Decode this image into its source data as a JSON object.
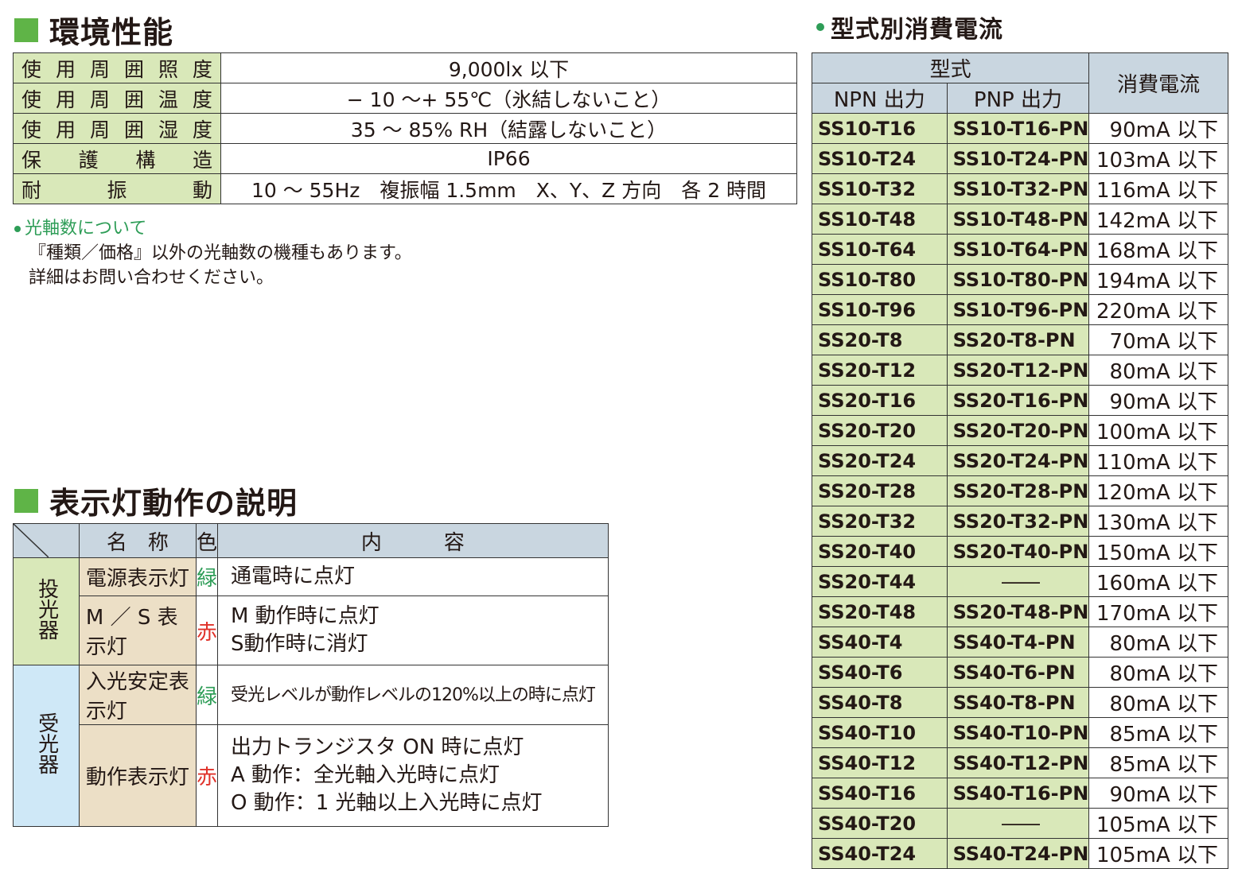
{
  "env": {
    "title": "環境性能",
    "rows": [
      {
        "label": "使用周囲照度",
        "value": "9,000lx 以下"
      },
      {
        "label": "使用周囲温度",
        "value": "− 10 〜+ 55℃（氷結しないこと）"
      },
      {
        "label": "使用周囲湿度",
        "value": "35 〜 85% RH（結露しないこと）"
      },
      {
        "label": "保護構造",
        "value": "IP66"
      },
      {
        "label": "耐振動",
        "value": "10 〜 55Hz　複振幅 1.5mm　X、Y、Z 方向　各 2 時間"
      }
    ]
  },
  "note": {
    "title": "光軸数について",
    "lines": [
      "『種類／価格』以外の光軸数の機種もあります。",
      "詳細はお問い合わせください。"
    ]
  },
  "indicator": {
    "title": "表示灯動作の説明",
    "headers": {
      "name": "名　称",
      "color": "色",
      "content": "内　　　容"
    },
    "groups": [
      {
        "label": "投光器",
        "rows": [
          {
            "name": "電源表示灯",
            "color": "緑",
            "content": [
              "通電時に点灯"
            ]
          },
          {
            "name": "M ／ S 表示灯",
            "color": "赤",
            "content": [
              "M 動作時に点灯",
              "S動作時に消灯"
            ]
          }
        ]
      },
      {
        "label": "受光器",
        "rows": [
          {
            "name": "入光安定表示灯",
            "color": "緑",
            "content": [
              "受光レベルが動作レベルの120%以上の時に点灯"
            ]
          },
          {
            "name": "動作表示灯",
            "color": "赤",
            "content": [
              "出力トランジスタ ON 時に点灯",
              "A 動作：全光軸入光時に点灯",
              "O 動作：1 光軸以上入光時に点灯"
            ]
          }
        ]
      }
    ]
  },
  "current": {
    "title": "型式別消費電流",
    "headers": {
      "model": "型式",
      "npn": "NPN 出力",
      "pnp": "PNP 出力",
      "current": "消費電流"
    },
    "rows": [
      {
        "npn": "SS10-T16",
        "pnp": "SS10-T16-PN",
        "current": "90mA 以下"
      },
      {
        "npn": "SS10-T24",
        "pnp": "SS10-T24-PN",
        "current": "103mA 以下"
      },
      {
        "npn": "SS10-T32",
        "pnp": "SS10-T32-PN",
        "current": "116mA 以下"
      },
      {
        "npn": "SS10-T48",
        "pnp": "SS10-T48-PN",
        "current": "142mA 以下"
      },
      {
        "npn": "SS10-T64",
        "pnp": "SS10-T64-PN",
        "current": "168mA 以下"
      },
      {
        "npn": "SS10-T80",
        "pnp": "SS10-T80-PN",
        "current": "194mA 以下"
      },
      {
        "npn": "SS10-T96",
        "pnp": "SS10-T96-PN",
        "current": "220mA 以下"
      },
      {
        "npn": "SS20-T8",
        "pnp": "SS20-T8-PN",
        "current": "70mA 以下"
      },
      {
        "npn": "SS20-T12",
        "pnp": "SS20-T12-PN",
        "current": "80mA 以下"
      },
      {
        "npn": "SS20-T16",
        "pnp": "SS20-T16-PN",
        "current": "90mA 以下"
      },
      {
        "npn": "SS20-T20",
        "pnp": "SS20-T20-PN",
        "current": "100mA 以下"
      },
      {
        "npn": "SS20-T24",
        "pnp": "SS20-T24-PN",
        "current": "110mA 以下"
      },
      {
        "npn": "SS20-T28",
        "pnp": "SS20-T28-PN",
        "current": "120mA 以下"
      },
      {
        "npn": "SS20-T32",
        "pnp": "SS20-T32-PN",
        "current": "130mA 以下"
      },
      {
        "npn": "SS20-T40",
        "pnp": "SS20-T40-PN",
        "current": "150mA 以下"
      },
      {
        "npn": "SS20-T44",
        "pnp": "――",
        "current": "160mA 以下"
      },
      {
        "npn": "SS20-T48",
        "pnp": "SS20-T48-PN",
        "current": "170mA 以下"
      },
      {
        "npn": "SS40-T4",
        "pnp": "SS40-T4-PN",
        "current": "80mA 以下"
      },
      {
        "npn": "SS40-T6",
        "pnp": "SS40-T6-PN",
        "current": "80mA 以下"
      },
      {
        "npn": "SS40-T8",
        "pnp": "SS40-T8-PN",
        "current": "80mA 以下"
      },
      {
        "npn": "SS40-T10",
        "pnp": "SS40-T10-PN",
        "current": "85mA 以下"
      },
      {
        "npn": "SS40-T12",
        "pnp": "SS40-T12-PN",
        "current": "85mA 以下"
      },
      {
        "npn": "SS40-T16",
        "pnp": "SS40-T16-PN",
        "current": "90mA 以下"
      },
      {
        "npn": "SS40-T20",
        "pnp": "――",
        "current": "105mA 以下"
      },
      {
        "npn": "SS40-T24",
        "pnp": "SS40-T24-PN",
        "current": "105mA 以下"
      }
    ]
  },
  "colors": {
    "green_square": "#5fb447",
    "label_green": "#d9e8b9",
    "header_blue": "#c9d6e0",
    "beige": "#ecdfc6",
    "light_blue": "#cfe8f7",
    "text_green": "#2e9d57",
    "text_red": "#e0322a"
  }
}
